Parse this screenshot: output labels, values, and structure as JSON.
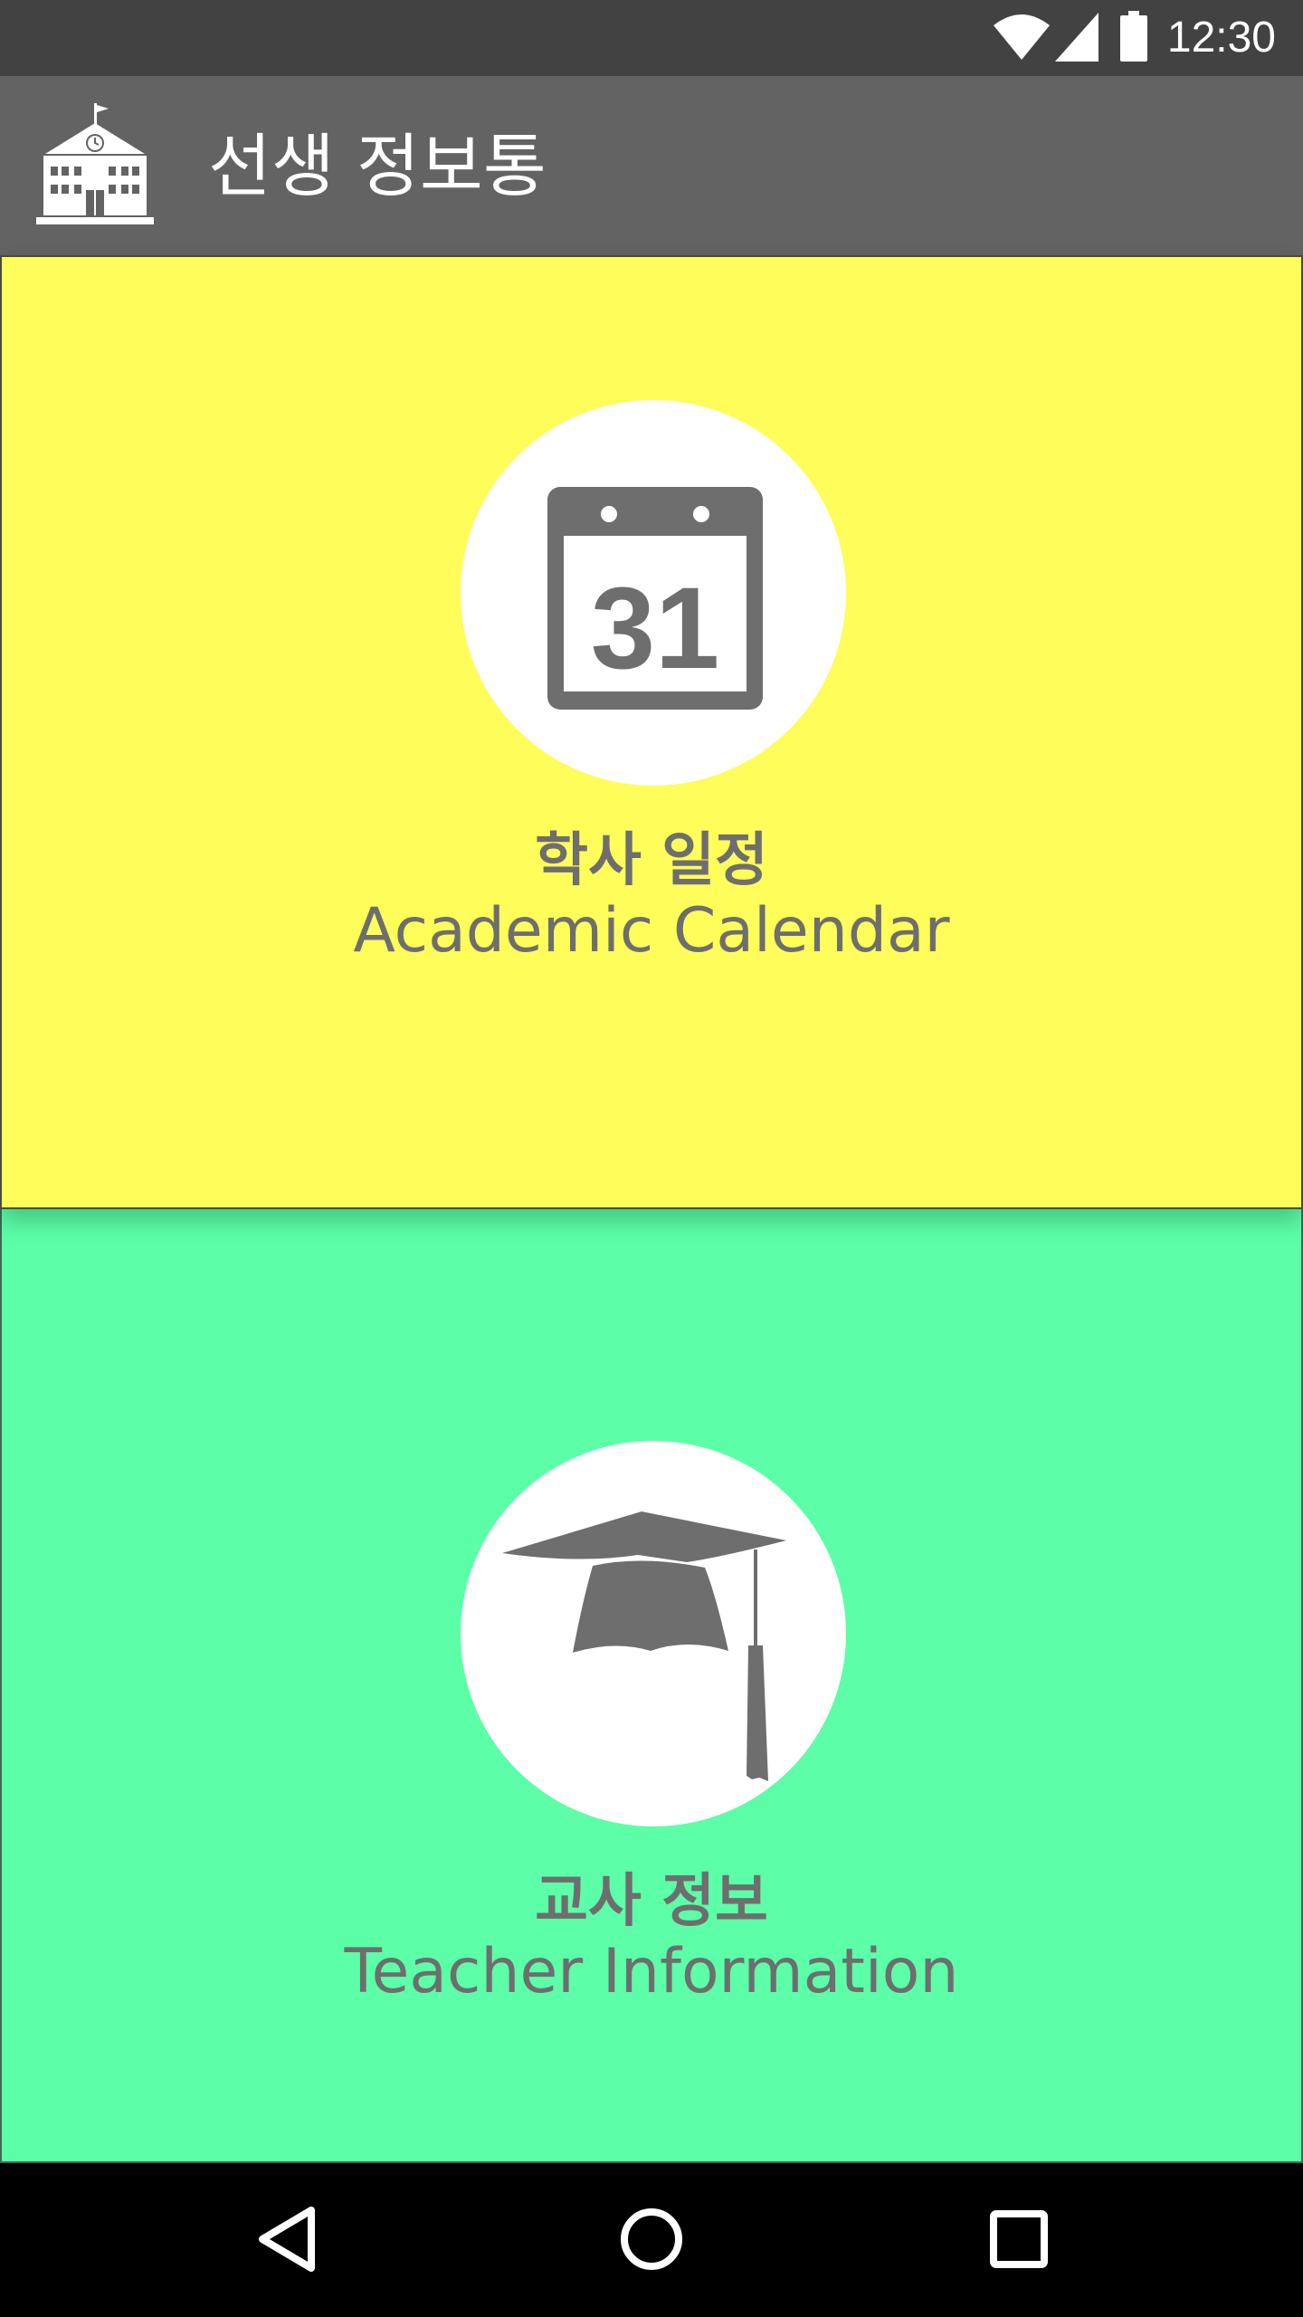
{
  "status_bar": {
    "time": "12:30",
    "icons": [
      "wifi-icon",
      "cell-signal-icon",
      "battery-icon"
    ]
  },
  "app_bar": {
    "title": "선생 정보통",
    "logo_icon": "school-building-icon"
  },
  "tiles": [
    {
      "title": "학사 일정",
      "subtitle": "Academic Calendar",
      "icon": "calendar-icon",
      "icon_text": "31",
      "background": "#fffd5a"
    },
    {
      "title": "교사 정보",
      "subtitle": "Teacher Information",
      "icon": "graduation-cap-icon",
      "background": "#5cffa8"
    }
  ],
  "colors": {
    "status_bar": "#424242",
    "app_bar": "#636363",
    "icon_gray": "#6e6e6e",
    "nav_bar": "#000000"
  },
  "nav_bar": {
    "buttons": [
      "back-icon",
      "home-icon",
      "recents-icon"
    ]
  }
}
